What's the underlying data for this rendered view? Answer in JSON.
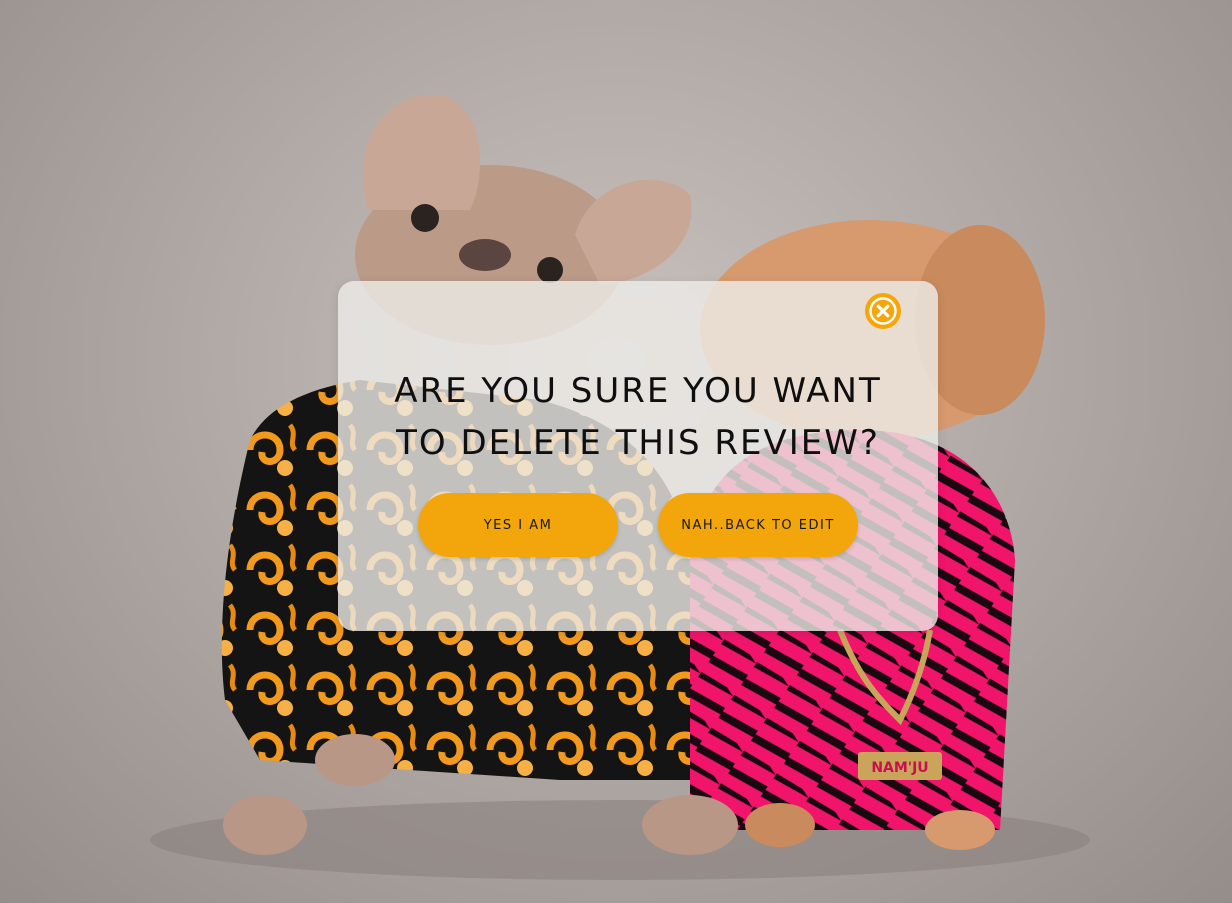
{
  "dialog": {
    "title": "ARE YOU SURE YOU WANT TO DELETE THIS REVIEW?",
    "confirm_label": "YES I AM",
    "cancel_label": "NAH..BACK TO EDIT",
    "close_icon": "close-circle-icon",
    "accent_color": "#F2A60C"
  },
  "background": {
    "subject": "two dogs wearing printed jackets",
    "badge_text": "NAM'JU"
  }
}
